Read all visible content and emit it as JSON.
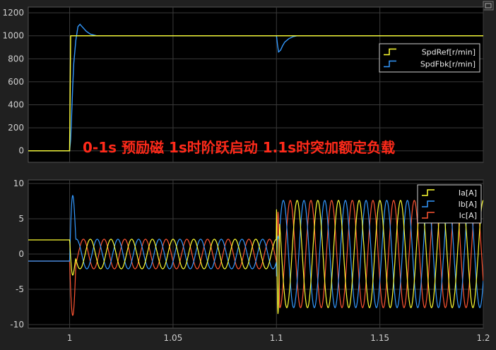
{
  "annotation": "0-1s 预励磁  1s时阶跃启动  1.1s时突加额定负载",
  "colors": {
    "background": "#202020",
    "axes_background": "#000000",
    "grid": "#3a3a3a",
    "yellow": "#ffff33",
    "blue": "#3399ff",
    "red": "#ff5533",
    "annotation": "#ff2a1a"
  },
  "chart_data": [
    {
      "type": "line",
      "grid": true,
      "legend_position": "top-right",
      "xlim": [
        0.98,
        1.2
      ],
      "ylim": [
        -100,
        1250
      ],
      "yticks": [
        0,
        200,
        400,
        600,
        800,
        1000,
        1200
      ],
      "series": [
        {
          "name": "SpdRef[r/min]",
          "color": "#ffff33",
          "x": [
            0.98,
            1.0,
            1.0005,
            1.001,
            1.2
          ],
          "y": [
            0,
            0,
            1000,
            1000,
            1000
          ]
        },
        {
          "name": "SpdFbk[r/min]",
          "color": "#3399ff",
          "x": [
            0.98,
            1.0,
            1.0005,
            1.001,
            1.0015,
            1.002,
            1.003,
            1.004,
            1.005,
            1.006,
            1.008,
            1.01,
            1.013,
            1.1,
            1.1005,
            1.101,
            1.102,
            1.103,
            1.104,
            1.106,
            1.108,
            1.11,
            1.2
          ],
          "y": [
            0,
            0,
            100,
            330,
            560,
            760,
            960,
            1080,
            1100,
            1080,
            1040,
            1015,
            1000,
            1000,
            925,
            860,
            875,
            915,
            945,
            975,
            992,
            1000,
            1000
          ]
        }
      ]
    },
    {
      "type": "line",
      "grid": true,
      "legend_position": "top-right",
      "xlim": [
        0.98,
        1.2
      ],
      "ylim": [
        -10.5,
        10.5
      ],
      "yticks": [
        -10,
        -5,
        0,
        5,
        10
      ],
      "xticks": [
        1,
        1.05,
        1.1,
        1.15,
        1.2
      ],
      "xticklabels": [
        "1",
        "1.05",
        "1.1",
        "1.15",
        "1.2"
      ],
      "current_model": {
        "prefix_time": 1.0,
        "prefix_values": [
          2,
          -1,
          -1
        ],
        "pre_load_amplitude": 2.1,
        "post_load_amplitude": 7.6,
        "load_time": 1.1,
        "period": 0.01,
        "phase_shifts_deg": [
          0,
          -120,
          120
        ]
      },
      "series": [
        {
          "name": "Ia[A]",
          "color": "#ffff33"
        },
        {
          "name": "Ib[A]",
          "color": "#3399ff"
        },
        {
          "name": "Ic[A]",
          "color": "#ff5533"
        }
      ]
    }
  ]
}
